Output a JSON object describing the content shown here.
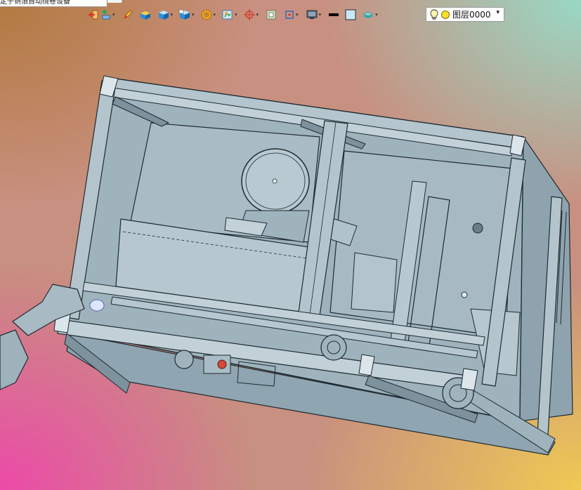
{
  "window": {
    "title": "定子铜箔自动绕卷设备"
  },
  "toolbar": {
    "dropdown_arrow": "▾",
    "buttons": [
      {
        "name": "exit-tool",
        "icon": "exit-icon",
        "has_menu": false
      },
      {
        "name": "insert-tool",
        "icon": "insert-icon",
        "has_menu": true
      },
      {
        "name": "pencil-tool",
        "icon": "pencil-icon",
        "has_menu": false
      },
      {
        "name": "box-tool",
        "icon": "box-icon",
        "has_menu": false
      },
      {
        "name": "shaded-cube-tool",
        "icon": "shaded-cube-icon",
        "has_menu": true
      },
      {
        "name": "section-view-tool",
        "icon": "section-cube-icon",
        "has_menu": true
      },
      {
        "name": "display-style-tool",
        "icon": "wheel-icon",
        "has_menu": true
      },
      {
        "name": "view-orient-tool",
        "icon": "view-orient-icon",
        "has_menu": true
      },
      {
        "name": "triad-tool",
        "icon": "triad-icon",
        "has_menu": true
      },
      {
        "name": "viewport-tool",
        "icon": "viewport-icon",
        "has_menu": false
      },
      {
        "name": "measure-tool",
        "icon": "measure-icon",
        "has_menu": true
      },
      {
        "name": "monitor-tool",
        "icon": "monitor-icon",
        "has_menu": true
      },
      {
        "name": "line-color-tool",
        "icon": "line-color-icon",
        "has_menu": false
      },
      {
        "name": "fill-color-tool",
        "icon": "fill-color-icon",
        "has_menu": false
      },
      {
        "name": "layers-tool",
        "icon": "layers-icon",
        "has_menu": true
      }
    ]
  },
  "layer_selector": {
    "value": "图层0000",
    "arrow": "▾"
  },
  "colors": {
    "model_fill": "#a9bcc6",
    "model_fill_dark": "#8fa5b1",
    "model_edge": "#1e2a30",
    "toolbar_accent_blue": "#2a8fd8",
    "toolbar_accent_orange": "#f0a020",
    "toolbar_accent_red": "#d43a2a"
  }
}
